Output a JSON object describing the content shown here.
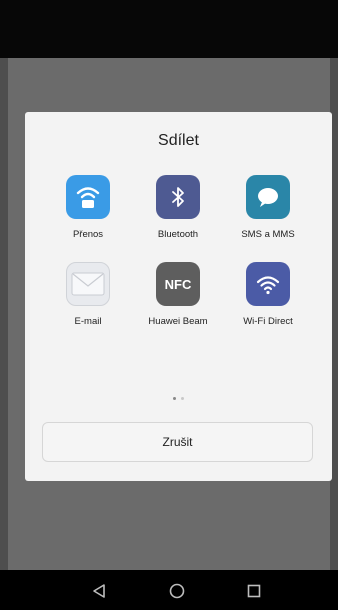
{
  "dialog": {
    "title": "Sdílet",
    "cancel_label": "Zrušit"
  },
  "share_targets": [
    {
      "label": "Přenos",
      "icon": "wifi-transfer-icon",
      "color": "#3a9be6"
    },
    {
      "label": "Bluetooth",
      "icon": "bluetooth-icon",
      "color": "#4e5a92"
    },
    {
      "label": "SMS a MMS",
      "icon": "message-bubble-icon",
      "color": "#2a86a8"
    },
    {
      "label": "E-mail",
      "icon": "envelope-icon",
      "color": "#e8eaee"
    },
    {
      "label": "Huawei Beam",
      "icon": "nfc-icon",
      "color": "#5e5e5e"
    },
    {
      "label": "Wi-Fi Direct",
      "icon": "wifi-icon",
      "color": "#4b5ba6"
    }
  ],
  "page_indicator": {
    "current": 1,
    "total": 2
  },
  "nav_bar": [
    "back-icon",
    "home-icon",
    "recents-icon"
  ]
}
